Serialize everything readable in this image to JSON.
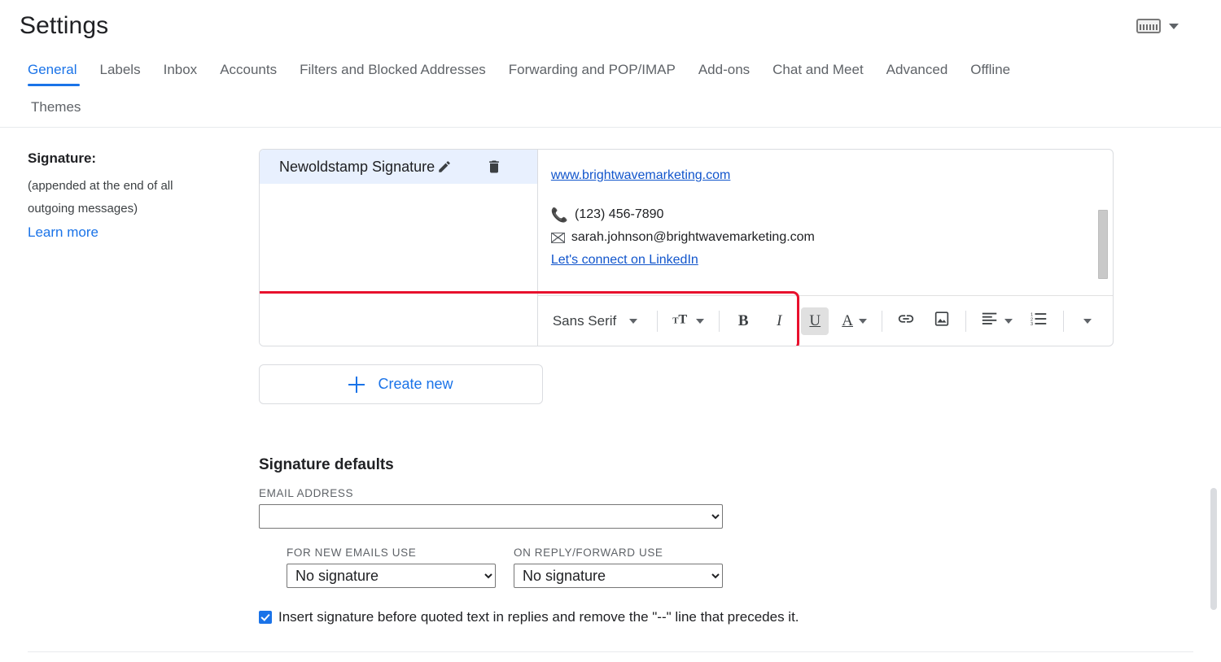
{
  "header": {
    "title": "Settings",
    "keyboard_icon": "keyboard-icon",
    "dropdown_icon": "chevron-down-icon"
  },
  "tabs": [
    {
      "label": "General",
      "active": true
    },
    {
      "label": "Labels",
      "active": false
    },
    {
      "label": "Inbox",
      "active": false
    },
    {
      "label": "Accounts",
      "active": false
    },
    {
      "label": "Filters and Blocked Addresses",
      "active": false
    },
    {
      "label": "Forwarding and POP/IMAP",
      "active": false
    },
    {
      "label": "Add-ons",
      "active": false
    },
    {
      "label": "Chat and Meet",
      "active": false
    },
    {
      "label": "Advanced",
      "active": false
    },
    {
      "label": "Offline",
      "active": false
    },
    {
      "label": "Themes",
      "active": false
    }
  ],
  "signature_section": {
    "label": "Signature:",
    "description_line1": "(appended at the end of all",
    "description_line2": "outgoing messages)",
    "learn_more": "Learn more",
    "list": [
      {
        "name": "Newoldstamp Signature",
        "selected": true
      }
    ],
    "edit_icon": "pencil-icon",
    "delete_icon": "trash-icon",
    "create_new_label": "Create new",
    "create_new_icon": "plus-icon"
  },
  "signature_content": {
    "website": "www.brightwavemarketing.com",
    "phone": "(123) 456-7890",
    "email": "sarah.johnson@brightwavemarketing.com",
    "linkedin": "Let's connect on LinkedIn",
    "phone_icon": "phone-icon",
    "email_icon": "envelope-icon"
  },
  "format_toolbar": {
    "font_name": "Sans Serif",
    "font_dropdown_icon": "chevron-down-icon",
    "size_icon": "text-size-icon",
    "size_dropdown_icon": "chevron-down-icon",
    "bold": "B",
    "italic": "I",
    "underline": "U",
    "text_color": "A",
    "text_color_dropdown_icon": "chevron-down-icon",
    "link_icon": "link-icon",
    "image_icon": "insert-image-icon",
    "align_icon": "align-left-icon",
    "align_dropdown_icon": "chevron-down-icon",
    "list_icon": "numbered-list-icon",
    "more_icon": "chevron-down-icon",
    "active_button": "U",
    "highlight_color": "#e8112d"
  },
  "defaults": {
    "title": "Signature defaults",
    "email_address_label": "EMAIL ADDRESS",
    "email_address_value": "",
    "email_address_options": [
      ""
    ],
    "new_emails_label": "FOR NEW EMAILS USE",
    "new_emails_value": "No signature",
    "new_emails_options": [
      "No signature",
      "Newoldstamp Signature"
    ],
    "reply_forward_label": "ON REPLY/FORWARD USE",
    "reply_forward_value": "No signature",
    "reply_forward_options": [
      "No signature",
      "Newoldstamp Signature"
    ],
    "checkbox_label": "Insert signature before quoted text in replies and remove the \"--\" line that precedes it.",
    "checkbox_checked": true
  },
  "colors": {
    "accent": "#1a73e8",
    "selected_row": "#e8f0fe",
    "link": "#1155cc",
    "highlight": "#e8112d"
  }
}
